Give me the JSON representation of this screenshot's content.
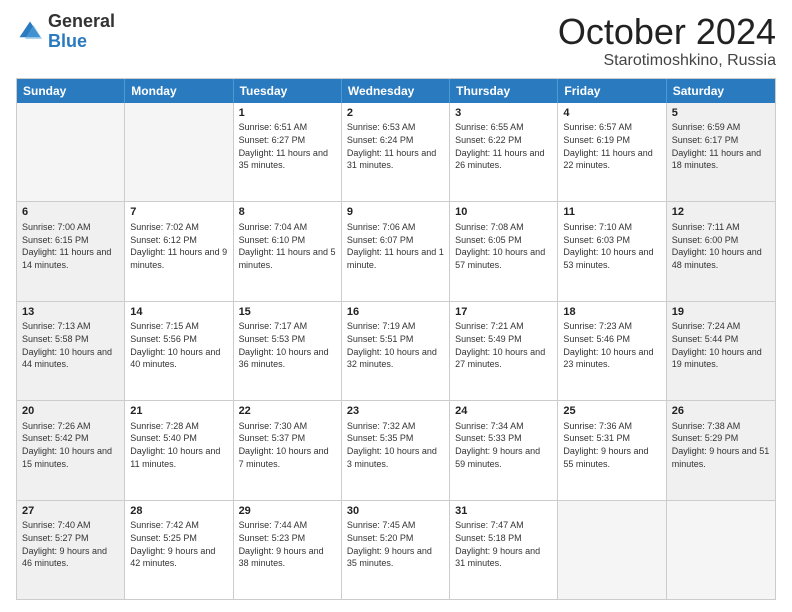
{
  "logo": {
    "general": "General",
    "blue": "Blue"
  },
  "title": {
    "month": "October 2024",
    "location": "Starotimoshkino, Russia"
  },
  "weekdays": [
    "Sunday",
    "Monday",
    "Tuesday",
    "Wednesday",
    "Thursday",
    "Friday",
    "Saturday"
  ],
  "weeks": [
    [
      {
        "day": "",
        "info": "",
        "empty": true
      },
      {
        "day": "",
        "info": "",
        "empty": true
      },
      {
        "day": "1",
        "info": "Sunrise: 6:51 AM\nSunset: 6:27 PM\nDaylight: 11 hours and 35 minutes."
      },
      {
        "day": "2",
        "info": "Sunrise: 6:53 AM\nSunset: 6:24 PM\nDaylight: 11 hours and 31 minutes."
      },
      {
        "day": "3",
        "info": "Sunrise: 6:55 AM\nSunset: 6:22 PM\nDaylight: 11 hours and 26 minutes."
      },
      {
        "day": "4",
        "info": "Sunrise: 6:57 AM\nSunset: 6:19 PM\nDaylight: 11 hours and 22 minutes."
      },
      {
        "day": "5",
        "info": "Sunrise: 6:59 AM\nSunset: 6:17 PM\nDaylight: 11 hours and 18 minutes."
      }
    ],
    [
      {
        "day": "6",
        "info": "Sunrise: 7:00 AM\nSunset: 6:15 PM\nDaylight: 11 hours and 14 minutes."
      },
      {
        "day": "7",
        "info": "Sunrise: 7:02 AM\nSunset: 6:12 PM\nDaylight: 11 hours and 9 minutes."
      },
      {
        "day": "8",
        "info": "Sunrise: 7:04 AM\nSunset: 6:10 PM\nDaylight: 11 hours and 5 minutes."
      },
      {
        "day": "9",
        "info": "Sunrise: 7:06 AM\nSunset: 6:07 PM\nDaylight: 11 hours and 1 minute."
      },
      {
        "day": "10",
        "info": "Sunrise: 7:08 AM\nSunset: 6:05 PM\nDaylight: 10 hours and 57 minutes."
      },
      {
        "day": "11",
        "info": "Sunrise: 7:10 AM\nSunset: 6:03 PM\nDaylight: 10 hours and 53 minutes."
      },
      {
        "day": "12",
        "info": "Sunrise: 7:11 AM\nSunset: 6:00 PM\nDaylight: 10 hours and 48 minutes."
      }
    ],
    [
      {
        "day": "13",
        "info": "Sunrise: 7:13 AM\nSunset: 5:58 PM\nDaylight: 10 hours and 44 minutes."
      },
      {
        "day": "14",
        "info": "Sunrise: 7:15 AM\nSunset: 5:56 PM\nDaylight: 10 hours and 40 minutes."
      },
      {
        "day": "15",
        "info": "Sunrise: 7:17 AM\nSunset: 5:53 PM\nDaylight: 10 hours and 36 minutes."
      },
      {
        "day": "16",
        "info": "Sunrise: 7:19 AM\nSunset: 5:51 PM\nDaylight: 10 hours and 32 minutes."
      },
      {
        "day": "17",
        "info": "Sunrise: 7:21 AM\nSunset: 5:49 PM\nDaylight: 10 hours and 27 minutes."
      },
      {
        "day": "18",
        "info": "Sunrise: 7:23 AM\nSunset: 5:46 PM\nDaylight: 10 hours and 23 minutes."
      },
      {
        "day": "19",
        "info": "Sunrise: 7:24 AM\nSunset: 5:44 PM\nDaylight: 10 hours and 19 minutes."
      }
    ],
    [
      {
        "day": "20",
        "info": "Sunrise: 7:26 AM\nSunset: 5:42 PM\nDaylight: 10 hours and 15 minutes."
      },
      {
        "day": "21",
        "info": "Sunrise: 7:28 AM\nSunset: 5:40 PM\nDaylight: 10 hours and 11 minutes."
      },
      {
        "day": "22",
        "info": "Sunrise: 7:30 AM\nSunset: 5:37 PM\nDaylight: 10 hours and 7 minutes."
      },
      {
        "day": "23",
        "info": "Sunrise: 7:32 AM\nSunset: 5:35 PM\nDaylight: 10 hours and 3 minutes."
      },
      {
        "day": "24",
        "info": "Sunrise: 7:34 AM\nSunset: 5:33 PM\nDaylight: 9 hours and 59 minutes."
      },
      {
        "day": "25",
        "info": "Sunrise: 7:36 AM\nSunset: 5:31 PM\nDaylight: 9 hours and 55 minutes."
      },
      {
        "day": "26",
        "info": "Sunrise: 7:38 AM\nSunset: 5:29 PM\nDaylight: 9 hours and 51 minutes."
      }
    ],
    [
      {
        "day": "27",
        "info": "Sunrise: 7:40 AM\nSunset: 5:27 PM\nDaylight: 9 hours and 46 minutes."
      },
      {
        "day": "28",
        "info": "Sunrise: 7:42 AM\nSunset: 5:25 PM\nDaylight: 9 hours and 42 minutes."
      },
      {
        "day": "29",
        "info": "Sunrise: 7:44 AM\nSunset: 5:23 PM\nDaylight: 9 hours and 38 minutes."
      },
      {
        "day": "30",
        "info": "Sunrise: 7:45 AM\nSunset: 5:20 PM\nDaylight: 9 hours and 35 minutes."
      },
      {
        "day": "31",
        "info": "Sunrise: 7:47 AM\nSunset: 5:18 PM\nDaylight: 9 hours and 31 minutes."
      },
      {
        "day": "",
        "info": "",
        "empty": true
      },
      {
        "day": "",
        "info": "",
        "empty": true
      }
    ]
  ]
}
